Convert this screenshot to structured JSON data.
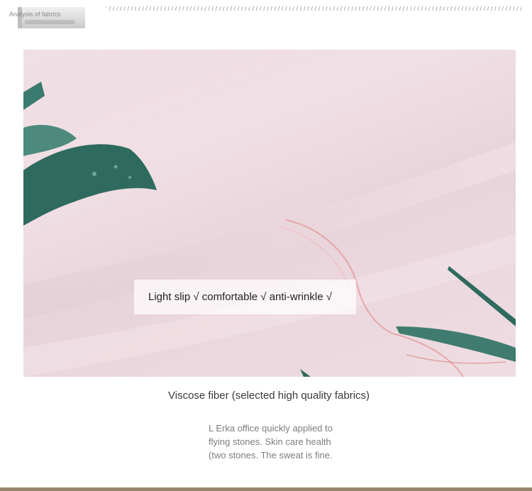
{
  "header": {
    "label": "Analysis of fabrics"
  },
  "photo": {
    "caption": "Light slip √ comfortable √ anti-wrinkle √"
  },
  "subtitle": "Viscose fiber (selected high quality fabrics)",
  "description": {
    "lines": [
      "L Erka office quickly applied to",
      "flying stones. Skin care health",
      "(two stones. The sweat is fine."
    ]
  },
  "colors": {
    "fabric_pink": "#ecd9df",
    "leaf_green": "#2f6a5f",
    "accent_brown": "#9a8670"
  }
}
